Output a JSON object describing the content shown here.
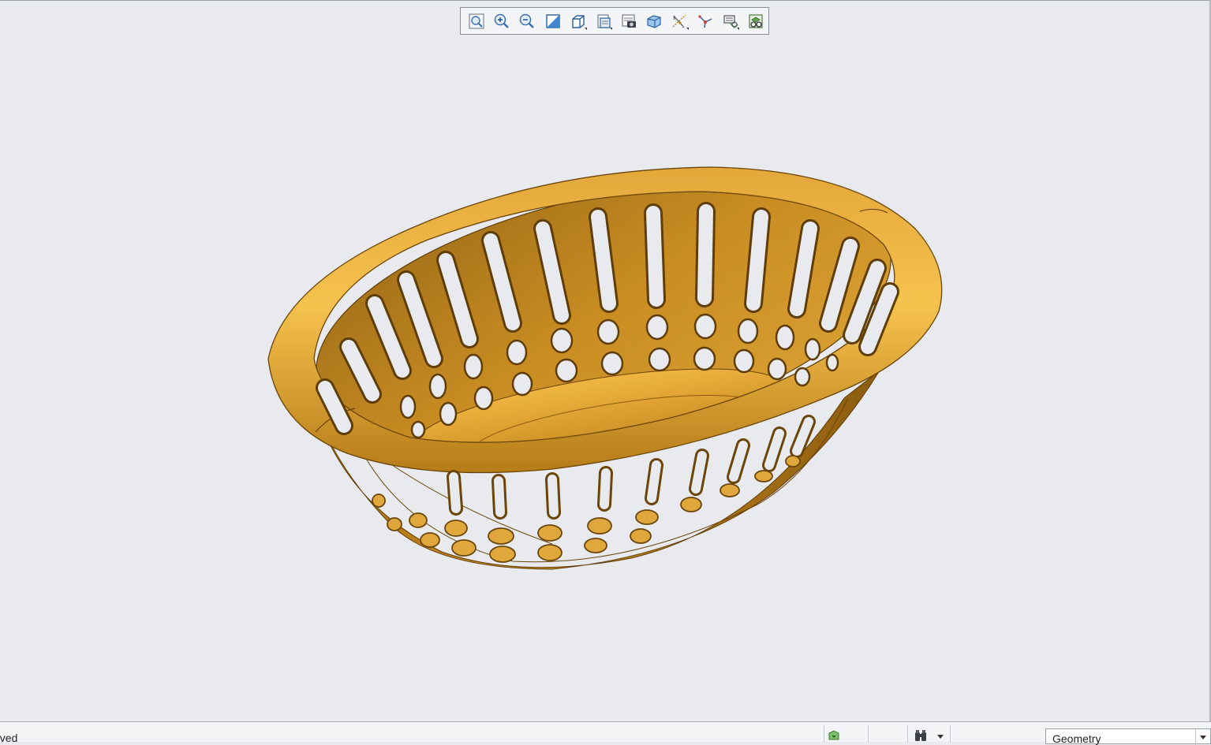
{
  "toolbar": {
    "buttons": [
      {
        "name": "refit-icon"
      },
      {
        "name": "zoom-in-icon"
      },
      {
        "name": "zoom-out-icon"
      },
      {
        "name": "repaint-icon"
      },
      {
        "name": "display-style-icon"
      },
      {
        "name": "saved-orientations-icon"
      },
      {
        "name": "view-manager-icon"
      },
      {
        "name": "perspective-view-icon"
      },
      {
        "name": "datum-display-icon"
      },
      {
        "name": "annotation-display-icon"
      },
      {
        "name": "spin-center-icon"
      },
      {
        "name": "appearance-icon"
      }
    ]
  },
  "model": {
    "color": "#d79a2a",
    "shadow": "#8c5d10",
    "highlight": "#f6c24e"
  },
  "status": {
    "message": "aved"
  },
  "filter": {
    "selected": "Geometry"
  }
}
